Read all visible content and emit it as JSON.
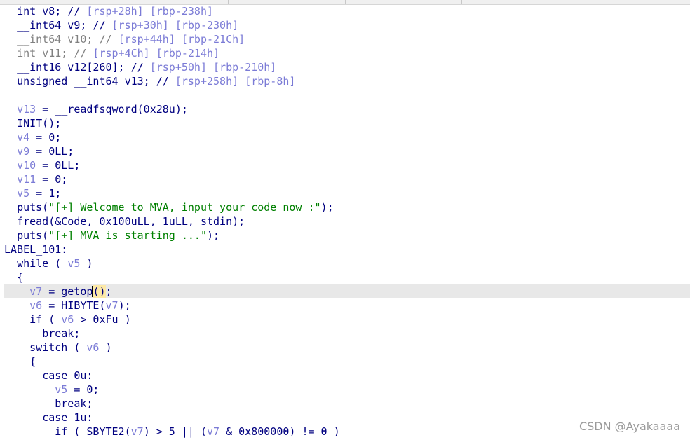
{
  "decompiler": {
    "lines": [
      {
        "indent": "  ",
        "tokens": [
          {
            "t": "int v8; // ",
            "c": "kw"
          },
          {
            "t": "[rsp+28h] [rbp-238h]",
            "c": "cmt"
          }
        ]
      },
      {
        "indent": "  ",
        "tokens": [
          {
            "t": "__int64 v9; // ",
            "c": "kw"
          },
          {
            "t": "[rsp+30h] [rbp-230h]",
            "c": "cmt"
          }
        ]
      },
      {
        "indent": "  ",
        "tokens": [
          {
            "t": "__int64 v10; // ",
            "c": "gray"
          },
          {
            "t": "[rsp+44h] [rbp-21Ch]",
            "c": "cmt"
          }
        ]
      },
      {
        "indent": "  ",
        "tokens": [
          {
            "t": "int v11; // ",
            "c": "gray"
          },
          {
            "t": "[rsp+4Ch] [rbp-214h]",
            "c": "cmt"
          }
        ]
      },
      {
        "indent": "  ",
        "tokens": [
          {
            "t": "__int16 v12[260]; // ",
            "c": "kw"
          },
          {
            "t": "[rsp+50h] [rbp-210h]",
            "c": "cmt"
          }
        ]
      },
      {
        "indent": "  ",
        "tokens": [
          {
            "t": "unsigned __int64 v13; // ",
            "c": "kw"
          },
          {
            "t": "[rsp+258h] [rbp-8h]",
            "c": "cmt"
          }
        ]
      },
      {
        "indent": "",
        "tokens": []
      },
      {
        "indent": "  ",
        "tokens": [
          {
            "t": "v13",
            "c": "var"
          },
          {
            "t": " = __readfsqword(0x28u);",
            "c": "kw"
          }
        ]
      },
      {
        "indent": "  ",
        "tokens": [
          {
            "t": "INIT();",
            "c": "kw"
          }
        ]
      },
      {
        "indent": "  ",
        "tokens": [
          {
            "t": "v4",
            "c": "var"
          },
          {
            "t": " = 0;",
            "c": "kw"
          }
        ]
      },
      {
        "indent": "  ",
        "tokens": [
          {
            "t": "v9",
            "c": "var"
          },
          {
            "t": " = 0LL;",
            "c": "kw"
          }
        ]
      },
      {
        "indent": "  ",
        "tokens": [
          {
            "t": "v10",
            "c": "var"
          },
          {
            "t": " = 0LL;",
            "c": "kw"
          }
        ]
      },
      {
        "indent": "  ",
        "tokens": [
          {
            "t": "v11",
            "c": "var"
          },
          {
            "t": " = 0;",
            "c": "kw"
          }
        ]
      },
      {
        "indent": "  ",
        "tokens": [
          {
            "t": "v5",
            "c": "var"
          },
          {
            "t": " = 1;",
            "c": "kw"
          }
        ]
      },
      {
        "indent": "  ",
        "tokens": [
          {
            "t": "puts(",
            "c": "kw"
          },
          {
            "t": "\"[+] Welcome to MVA, input your code now :\"",
            "c": "str"
          },
          {
            "t": ");",
            "c": "kw"
          }
        ]
      },
      {
        "indent": "  ",
        "tokens": [
          {
            "t": "fread(&Code, 0x100uLL, 1uLL, stdin);",
            "c": "kw"
          }
        ]
      },
      {
        "indent": "  ",
        "tokens": [
          {
            "t": "puts(",
            "c": "kw"
          },
          {
            "t": "\"[+] MVA is starting ...\"",
            "c": "str"
          },
          {
            "t": ");",
            "c": "kw"
          }
        ]
      },
      {
        "indent": "",
        "tokens": [
          {
            "t": "LABEL_101:",
            "c": "kw"
          }
        ]
      },
      {
        "indent": "  ",
        "tokens": [
          {
            "t": "while ( ",
            "c": "kw"
          },
          {
            "t": "v5",
            "c": "var"
          },
          {
            "t": " )",
            "c": "kw"
          }
        ]
      },
      {
        "indent": "  ",
        "tokens": [
          {
            "t": "{",
            "c": "kw"
          }
        ]
      },
      {
        "indent": "    ",
        "highlight": true,
        "cursor": true,
        "tokens": [
          {
            "t": "v7",
            "c": "var"
          },
          {
            "t": " = getop",
            "c": "kw"
          },
          {
            "t": "(",
            "c": "kw",
            "hl": true
          },
          {
            "t": ")",
            "c": "kw",
            "hl": true
          },
          {
            "t": ";",
            "c": "kw"
          }
        ]
      },
      {
        "indent": "    ",
        "tokens": [
          {
            "t": "v6",
            "c": "var"
          },
          {
            "t": " = HIBYTE(",
            "c": "kw"
          },
          {
            "t": "v7",
            "c": "var"
          },
          {
            "t": ");",
            "c": "kw"
          }
        ]
      },
      {
        "indent": "    ",
        "tokens": [
          {
            "t": "if ( ",
            "c": "kw"
          },
          {
            "t": "v6",
            "c": "var"
          },
          {
            "t": " > 0xFu )",
            "c": "kw"
          }
        ]
      },
      {
        "indent": "      ",
        "tokens": [
          {
            "t": "break;",
            "c": "kw"
          }
        ]
      },
      {
        "indent": "    ",
        "tokens": [
          {
            "t": "switch ( ",
            "c": "kw"
          },
          {
            "t": "v6",
            "c": "var"
          },
          {
            "t": " )",
            "c": "kw"
          }
        ]
      },
      {
        "indent": "    ",
        "tokens": [
          {
            "t": "{",
            "c": "kw"
          }
        ]
      },
      {
        "indent": "      ",
        "tokens": [
          {
            "t": "case 0u:",
            "c": "kw"
          }
        ]
      },
      {
        "indent": "        ",
        "tokens": [
          {
            "t": "v5",
            "c": "var"
          },
          {
            "t": " = 0;",
            "c": "kw"
          }
        ]
      },
      {
        "indent": "        ",
        "tokens": [
          {
            "t": "break;",
            "c": "kw"
          }
        ]
      },
      {
        "indent": "      ",
        "tokens": [
          {
            "t": "case 1u:",
            "c": "kw"
          }
        ]
      },
      {
        "indent": "        ",
        "tokens": [
          {
            "t": "if ( SBYTE2(",
            "c": "kw"
          },
          {
            "t": "v7",
            "c": "var"
          },
          {
            "t": ") > 5 || (",
            "c": "kw"
          },
          {
            "t": "v7",
            "c": "var"
          },
          {
            "t": " & 0x800000) != 0 )",
            "c": "kw"
          }
        ]
      }
    ]
  },
  "watermark": "CSDN @Ayakaaaa",
  "colors": {
    "keyword": "#000080",
    "variable": "#7b7bd6",
    "string": "#008000",
    "comment": "#7b7bd6",
    "gray": "#808080",
    "line_highlight": "#e8e8e8",
    "paren_highlight": "#fde9a7"
  }
}
